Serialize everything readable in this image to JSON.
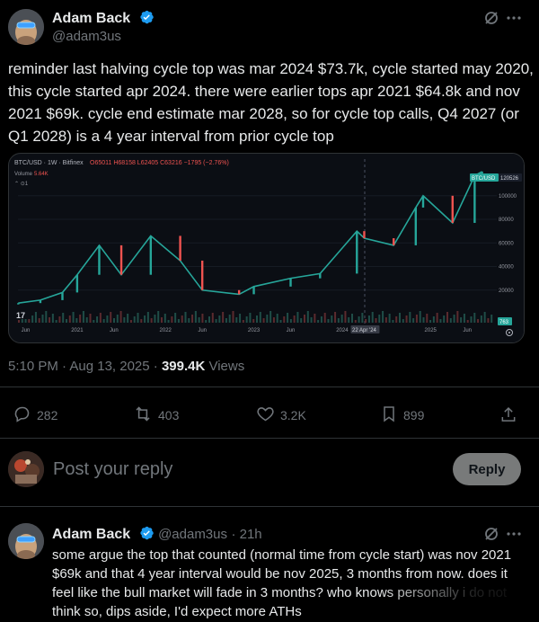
{
  "tweet": {
    "author_name": "Adam Back",
    "author_handle": "@adam3us",
    "text": "reminder last halving cycle top was mar 2024 $73.7k, cycle started may 2020, this cycle started apr 2024. there were earlier tops apr 2021 $64.8k and nov 2021 $69k. cycle end estimate mar 2028, so for cycle top calls, Q4 2027 (or Q1 2028) is a 4 year interval from prior cycle top",
    "time": "5:10 PM · Aug 13, 2025 · ",
    "views_count": "399.4K",
    "views_label": " Views",
    "more_icon": "more-horizontal-icon",
    "grok_icon": "grok-slash-icon"
  },
  "chart": {
    "header": "BTC/USD · 1W · Bitfinex",
    "ohlc": "O65011 H68158 L62405 C63216 −1795 (−2.76%)",
    "volume_label": "Volume",
    "volume_value": "5.64K",
    "price_tag_label": "BTC/USD",
    "price_tag_value": "120526",
    "volume_tag": "763",
    "y_ticks": [
      "100000",
      "80000",
      "60000",
      "40000",
      "20000"
    ],
    "x_ticks": [
      "Jun",
      "2021",
      "Jun",
      "2022",
      "Jun",
      "2023",
      "Jun",
      "2024",
      "22 Apr '24",
      "2025",
      "Jun"
    ],
    "legend_icons": "⌃ ⊙1"
  },
  "chart_data": {
    "type": "line",
    "title": "",
    "x": [
      "2020-05",
      "2020-08",
      "2020-11",
      "2021-01",
      "2021-04",
      "2021-07",
      "2021-11",
      "2022-03",
      "2022-06",
      "2022-11",
      "2023-01",
      "2023-06",
      "2023-10",
      "2024-03",
      "2024-04",
      "2024-08",
      "2024-11",
      "2024-12",
      "2025-04",
      "2025-07",
      "2025-08"
    ],
    "series": [
      {
        "values": [
          9000,
          11500,
          18000,
          33000,
          58000,
          33000,
          66000,
          45000,
          20000,
          16500,
          23000,
          30000,
          34000,
          70000,
          64000,
          58000,
          90000,
          100000,
          77000,
          117000,
          120526
        ]
      }
    ],
    "ylim": [
      0,
      125000
    ]
  },
  "stats": {
    "replies": "282",
    "reposts": "403",
    "likes": "3.2K",
    "bookmarks": "899"
  },
  "compose": {
    "placeholder": "Post your reply",
    "button": "Reply"
  },
  "reply": {
    "author_name": "Adam Back",
    "author_handle": "@adam3us",
    "time": "· 21h",
    "text": "some argue the top that counted (normal time from cycle start) was nov 2021 $69k and that 4 year interval would be nov 2025, 3 months from now. does it feel like the bull market will fade in 3 months? who knows personally i do not think so, dips aside, I'd expect more ATHs"
  }
}
